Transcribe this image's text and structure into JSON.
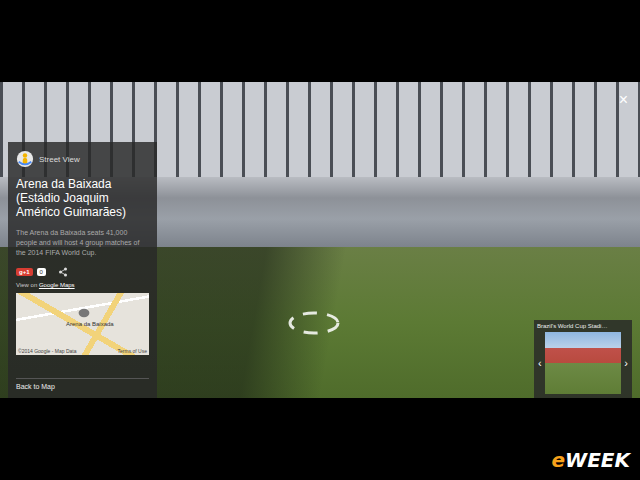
{
  "slide": {
    "logo_prefix": "e",
    "logo_name": "WEEK"
  },
  "viewer": {
    "mode": "Street View",
    "close": "×"
  },
  "place": {
    "title": "Arena da Baixada (Estádio Joaquim Américo Guimarães)",
    "description": "The Arena da Baixada seats 41,000 people and will host 4 group matches of the 2014 FIFA World Cup.",
    "plus_button": "g+1",
    "plus_count": "0",
    "link_prefix": "View on ",
    "link": "Google Maps",
    "map_label": "Arena da Baixada",
    "map_attribution": "©2014 Google - Map Data",
    "map_terms": "Terms of Use",
    "back": "Back to Map"
  },
  "gallery": {
    "title": "Brazil's World Cup Stadi…",
    "prev": "‹",
    "next": "›"
  }
}
